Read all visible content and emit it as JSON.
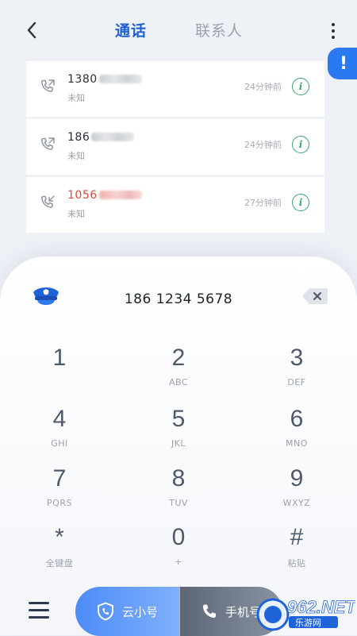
{
  "header": {
    "tabs": [
      {
        "label": "通话",
        "active": true
      },
      {
        "label": "联系人",
        "active": false
      }
    ],
    "alert_glyph": "!"
  },
  "calls": [
    {
      "number_prefix": "1380",
      "location": "未知",
      "time": "24分钟前",
      "missed": false
    },
    {
      "number_prefix": "186",
      "location": "未知",
      "time": "24分钟前",
      "missed": false
    },
    {
      "number_prefix": "1056",
      "location": "未知",
      "time": "27分钟前",
      "missed": true
    }
  ],
  "dialer": {
    "display_number": "186 1234 5678",
    "keys": [
      {
        "digit": "1",
        "letters": ""
      },
      {
        "digit": "2",
        "letters": "ABC"
      },
      {
        "digit": "3",
        "letters": "DEF"
      },
      {
        "digit": "4",
        "letters": "GHI"
      },
      {
        "digit": "5",
        "letters": "JKL"
      },
      {
        "digit": "6",
        "letters": "MNO"
      },
      {
        "digit": "7",
        "letters": "PQRS"
      },
      {
        "digit": "8",
        "letters": "TUV"
      },
      {
        "digit": "9",
        "letters": "WXYZ"
      },
      {
        "digit": "*",
        "letters": "全键盘"
      },
      {
        "digit": "0",
        "letters": "+"
      },
      {
        "digit": "#",
        "letters": "粘贴"
      }
    ]
  },
  "actions": {
    "cloud_call_label": "云小号",
    "phone_call_label": "手机号"
  },
  "watermark": {
    "logo_text": "962.NET",
    "sub_text": "乐游网"
  },
  "colors": {
    "accent": "#1f5fd6",
    "alert": "#2a79f0",
    "missed": "#e0453c",
    "info": "#3aa56a"
  }
}
